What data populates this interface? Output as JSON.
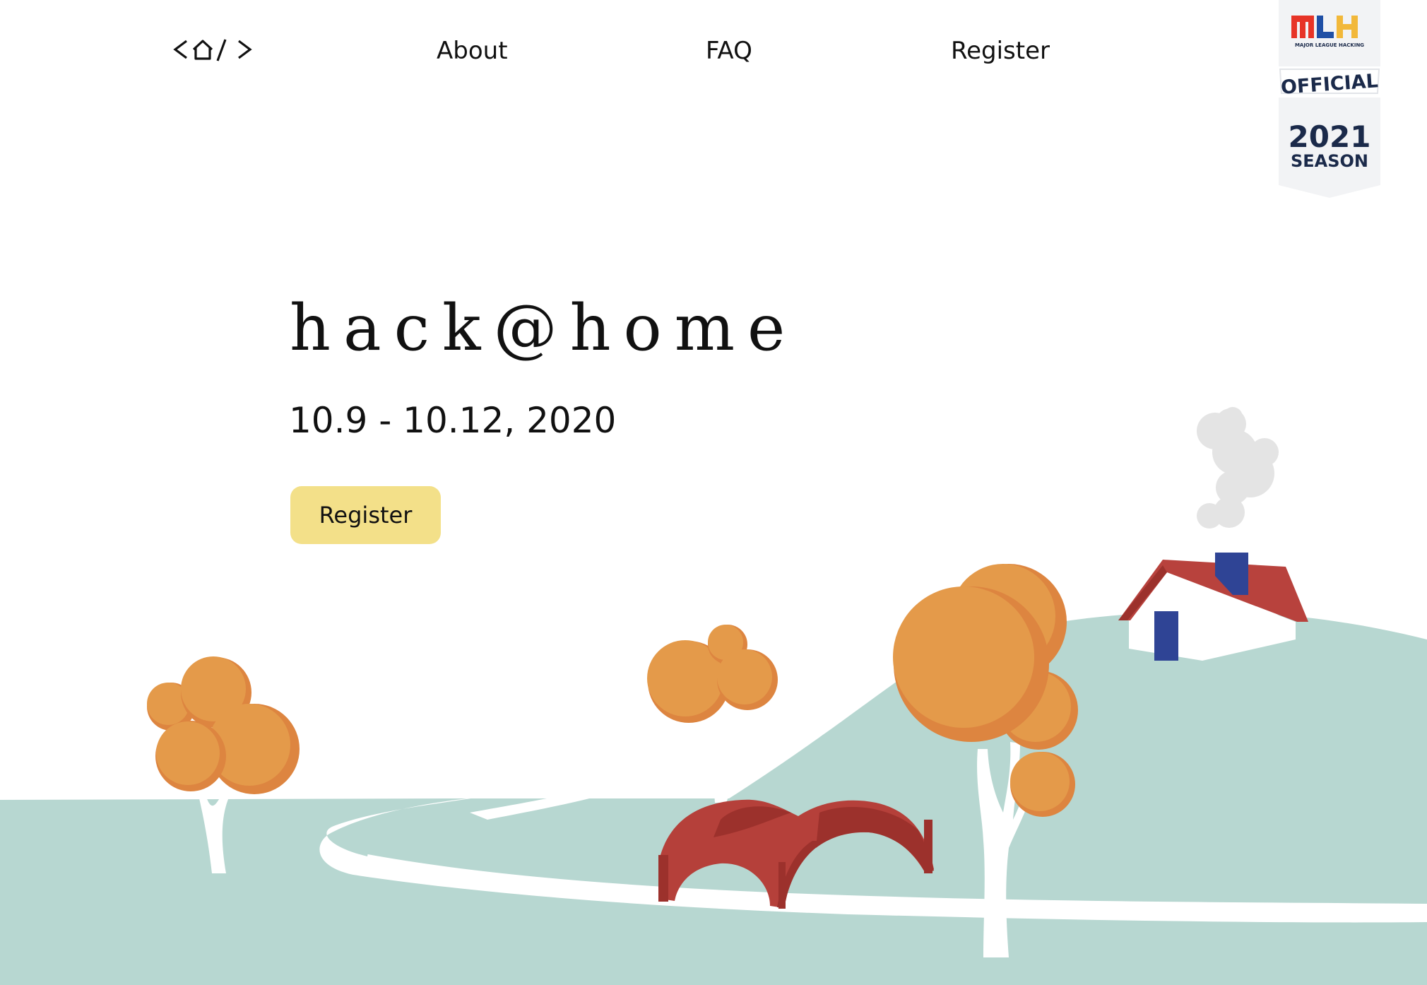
{
  "nav": {
    "logo_text": "<⌂/>",
    "links": [
      {
        "label": "About"
      },
      {
        "label": "FAQ"
      },
      {
        "label": "Register"
      }
    ]
  },
  "badge": {
    "logo": "MLH",
    "org": "MAJOR LEAGUE HACKING",
    "banner": "OFFICIAL",
    "year": "2021",
    "season": "SEASON"
  },
  "hero": {
    "title": "hack@home",
    "dates": "10.9 - 10.12, 2020",
    "cta_label": "Register"
  },
  "colors": {
    "hill": "#b7d7d1",
    "path": "#ffffff",
    "tree_light": "#e49a4a",
    "tree_dark": "#dd8540",
    "bridge": "#b5403a",
    "bridge_dark": "#9c312c",
    "roof": "#b8423d",
    "chimney": "#2f4495",
    "door": "#2f4495",
    "smoke": "#e4e4e4",
    "cta_bg": "#f3e089",
    "mlh_red": "#e73427",
    "mlh_blue": "#1f4fa5",
    "mlh_yellow": "#f2b83a",
    "mlh_navy": "#1b2a4a"
  }
}
